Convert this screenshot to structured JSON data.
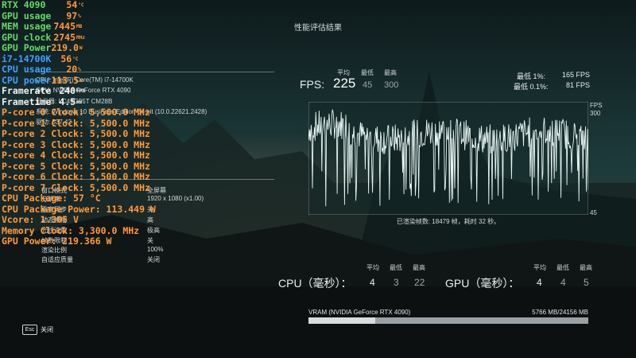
{
  "page": {
    "title": "性能评估结果"
  },
  "colors": {
    "osd_green": "#66d96a",
    "osd_orange": "#ff9a3c",
    "osd_blue": "#3fa0ff",
    "osd_white": "#f2f2f2",
    "graph_line": "#e6f5f3"
  },
  "system_info": [
    "CPU: Intel(R) Core(TM) i7-14700K",
    "GPU: NVIDIA GeForce RTX 4090",
    "显示器: LC49G95T CM28B",
    "系统: Windows 10 Business Edition 64-bit (10.0.22621.2428)",
    "驱动: 537.42"
  ],
  "settings": [
    {
      "label": "窗口模式",
      "value": "全屏幕"
    },
    {
      "label": "分辨率",
      "value": "1920 x 1080 (x1.00)"
    },
    {
      "label": "垂直同步",
      "value": "关"
    },
    {
      "label": "动态模糊",
      "value": "高"
    },
    {
      "label": "光线追踪",
      "value": "极高"
    },
    {
      "label": "帧数限制",
      "value": "关"
    },
    {
      "label": "渲染比例",
      "value": "100%"
    },
    {
      "label": "自适应质量",
      "value": "关闭"
    }
  ],
  "osd": {
    "gpu_name": "RTX 4090",
    "gpu_temp": "54",
    "gpu_temp_unit": "°C",
    "gpu_usage_label": "GPU usage",
    "gpu_usage": "97",
    "gpu_usage_unit": "%",
    "mem_usage_label": "MEM usage",
    "mem_usage": "7445",
    "mem_usage_unit": "MB",
    "gpu_clock_label": "GPU clock",
    "gpu_clock": "2745",
    "gpu_clock_unit": "MHz",
    "gpu_power_label": "GPU Power",
    "gpu_power": "219.0",
    "gpu_power_unit": "W",
    "cpu_name": "i7-14700K",
    "cpu_temp": "56",
    "cpu_temp_unit": "°C",
    "cpu_usage_label": "CPU usage",
    "cpu_usage": "20",
    "cpu_usage_unit": "%",
    "cpu_power_label": "CPU power",
    "cpu_power": "113.5",
    "cpu_power_unit": "W",
    "framerate_label": "Framerate",
    "framerate": "240",
    "framerate_unit": "FPS",
    "frametime_label": "Frametime",
    "frametime": "4.5",
    "frametime_unit": "ms",
    "pcore_lines": [
      "P-core 0 Clock: 5,500.0 MHz",
      "P-core 1 Clock: 5,500.0 MHz",
      "P-core 2 Clock: 5,500.0 MHz",
      "P-core 3 Clock: 5,500.0 MHz",
      "P-core 4 Clock: 5,500.0 MHz",
      "P-core 5 Clock: 5,500.0 MHz",
      "P-core 6 Clock: 5,500.0 MHz",
      "P-core 7 Clock: 5,500.0 MHz"
    ],
    "package_lines": [
      "CPU Package: 57 °C",
      "CPU Package Power: 113.449 W",
      "Vcore: 1.305 V",
      "Memory Clock: 3,300.0 MHz",
      "GPU Power: 219.366 W"
    ]
  },
  "fps": {
    "label": "FPS:",
    "avg_head": "平均",
    "min_head": "最低",
    "max_head": "最高",
    "avg": "225",
    "min": "45",
    "max": "300",
    "low1_label": "最低 1%:",
    "low1_value": "165 FPS",
    "low01_label": "最低 0.1%:",
    "low01_value": "81 FPS"
  },
  "graph": {
    "axis_unit": "FPS",
    "y_top": "300",
    "y_bottom": "45",
    "caption": "已渲染帧数: 18479 帧，耗时 32 秒。"
  },
  "cpu_stats": {
    "label": "CPU（毫秒）：",
    "avg_head": "平均",
    "min_head": "最低",
    "max_head": "最高",
    "avg": "4",
    "min": "3",
    "max": "22"
  },
  "gpu_stats": {
    "label": "GPU（毫秒）：",
    "avg_head": "平均",
    "min_head": "最低",
    "max_head": "最高",
    "avg": "4",
    "min": "4",
    "max": "5"
  },
  "vram": {
    "label": "VRAM (NVIDIA GeForce RTX 4090)",
    "value": "5766 MB/24156 MB",
    "fill_fraction": 0.239
  },
  "footer": {
    "esc_key": "Esc",
    "close_label": "关闭"
  }
}
